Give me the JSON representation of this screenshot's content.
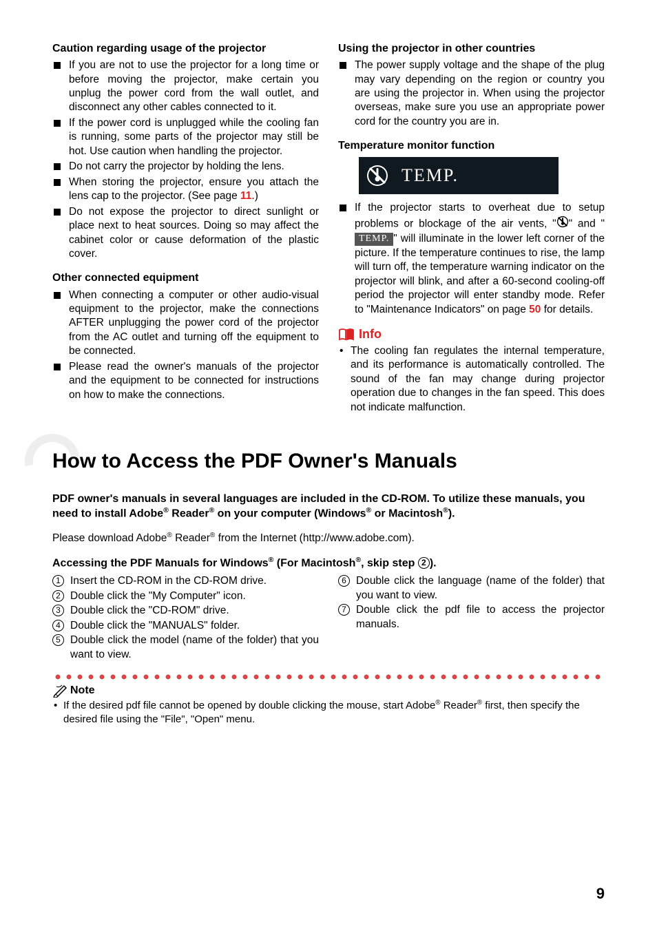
{
  "left": {
    "h1": "Caution regarding usage of the projector",
    "items1": [
      "If you are not to use the projector for a long time or before moving the projector, make certain you unplug the power cord from the wall outlet, and disconnect any other cables connected to it.",
      "If the power cord is unplugged while the cooling fan is running, some parts of the projector may still be hot. Use caution when handling the projector.",
      "Do not carry the projector by holding the lens."
    ],
    "item_seepage_pre": "When storing the projector, ensure you attach the lens cap to the projector. (See page ",
    "item_seepage_num": "11",
    "item_seepage_post": ".)",
    "item5": "Do not expose the projector to direct sunlight or place next to heat sources. Doing so may affect the cabinet color or cause deformation of the plastic cover.",
    "h2": "Other connected equipment",
    "items2": [
      "When connecting a computer or other audio-visual equipment to the projector, make the connections AFTER unplugging the power cord of the projector from the AC outlet and turning off the equipment to be connected.",
      "Please read the owner's manuals of the projector and the equipment to be connected for instructions on how to make the connections."
    ]
  },
  "right": {
    "h1": "Using the projector in other countries",
    "item1": "The power supply voltage and the shape of the plug may vary depending on the region or country you are using the projector in. When using the projector overseas, make sure you use an appropriate power cord for the country you are in.",
    "h2": "Temperature monitor function",
    "temp_label": "TEMP.",
    "temp_text_pre": "If the projector starts to overheat due to setup problems or blockage of the air vents, \"",
    "temp_text_mid": "\" and \"",
    "temp_inline": "TEMP.",
    "temp_text_post1": "\" will illuminate in the lower left corner of the picture. If the temperature continues to rise, the lamp will turn off, the temperature warning indicator on the projector will blink, and after a 60-second cooling-off period the projector will enter standby mode. Refer to \"Maintenance Indicators\" on page ",
    "temp_ref": "50",
    "temp_text_post2": " for details.",
    "info_label": "Info",
    "info_item": "The cooling fan regulates the internal temperature, and its performance is automatically controlled. The sound of the fan may change during projector operation due to changes in the fan speed. This does not indicate malfunction."
  },
  "main_title": "How to Access the PDF Owner's Manuals",
  "intro_bold_1": "PDF owner's manuals in several languages are included in the CD-ROM. To utilize these manuals, you need to install Adobe",
  "intro_bold_2": " Reader",
  "intro_bold_3": " on your computer (Windows",
  "intro_bold_4": " or Macintosh",
  "intro_bold_5": ").",
  "download_1": "Please download Adobe",
  "download_2": " Reader",
  "download_3": " from the Internet (",
  "download_url": "http://www.adobe.com",
  "download_4": ").",
  "access_h_1": "Accessing the PDF Manuals for Windows",
  "access_h_2": " (For Macintosh",
  "access_h_3": ", skip step ",
  "access_h_step": "2",
  "access_h_4": ").",
  "steps_left": [
    "Insert the CD-ROM in the CD-ROM drive.",
    "Double click the \"My Computer\" icon.",
    "Double click the \"CD-ROM\" drive.",
    "Double click the \"MANUALS\" folder.",
    "Double click the model (name of the folder) that you want to view."
  ],
  "steps_right": [
    "Double click the language (name of the folder) that you want to view.",
    "Double click the pdf file to access the projector manuals."
  ],
  "note_label": "Note",
  "note_body_1": "If the desired pdf file cannot be opened by double clicking the mouse, start Adobe",
  "note_body_2": " Reader",
  "note_body_3": " first, then specify the desired file using the \"File\", \"Open\" menu.",
  "page_number": "9"
}
